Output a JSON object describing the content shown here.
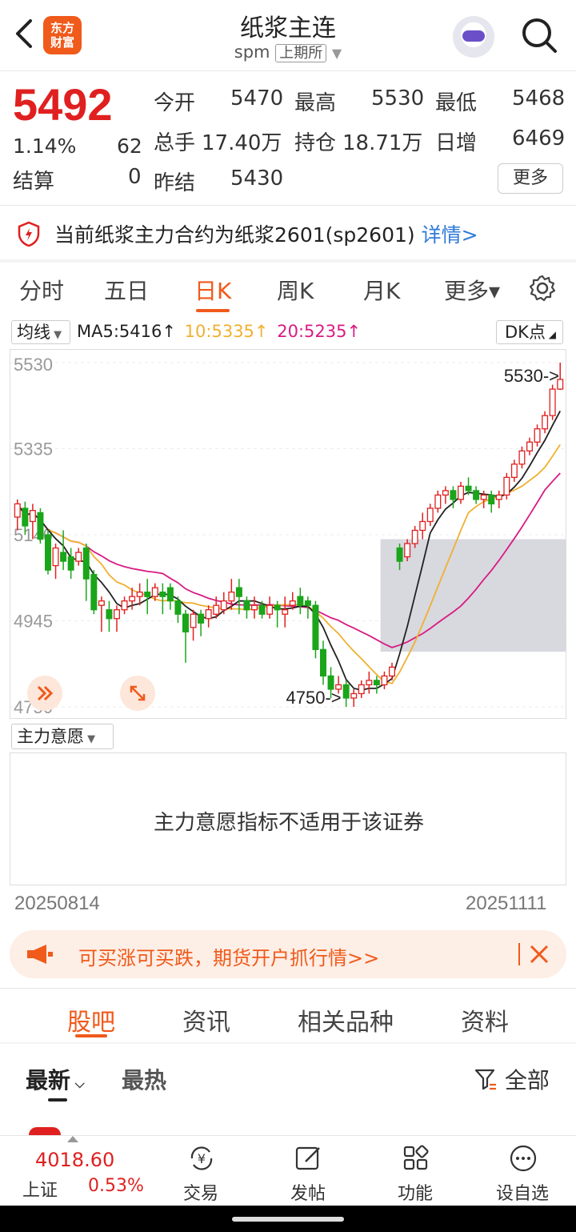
{
  "header": {
    "logo_text_1": "东方",
    "logo_text_2": "财富",
    "title": "纸浆主连",
    "code": "spm",
    "exchange": "上期所"
  },
  "quote": {
    "price": "5492",
    "change_pct": "1.14%",
    "change": "62",
    "settle_label": "结算",
    "settle": "0",
    "open_label": "今开",
    "open": "5470",
    "high_label": "最高",
    "high": "5530",
    "low_label": "最低",
    "low": "5468",
    "volume_label": "总手",
    "volume": "17.40万",
    "oi_label": "持仓",
    "oi": "18.71万",
    "daily_inc_label": "日增",
    "daily_inc": "6469",
    "prev_settle_label": "昨结",
    "prev_settle": "5430",
    "more": "更多"
  },
  "notice": {
    "text": "当前纸浆主力合约为纸浆2601(sp2601)",
    "link": "详情>"
  },
  "period_tabs": [
    "分时",
    "五日",
    "日K",
    "周K",
    "月K",
    "更多▾"
  ],
  "active_period": "日K",
  "ma_bar": {
    "select": "均线",
    "ma5": "MA5:5416",
    "ma10": "10:5335",
    "ma20": "20:5235",
    "arrow": "↑",
    "dk": "DK点"
  },
  "chart_data": {
    "type": "candlestick",
    "y_ticks": [
      "5530",
      "5335",
      "5140",
      "4945",
      "4750"
    ],
    "ylim": [
      4750,
      5530
    ],
    "x_start": "20250814",
    "x_end": "20251111",
    "high_marker": "5530->",
    "low_marker": "4750->",
    "candles": [
      [
        5180,
        5210,
        5150,
        5220
      ],
      [
        5200,
        5160,
        5140,
        5215
      ],
      [
        5170,
        5195,
        5130,
        5210
      ],
      [
        5190,
        5130,
        5120,
        5200
      ],
      [
        5140,
        5060,
        5050,
        5150
      ],
      [
        5070,
        5110,
        5040,
        5120
      ],
      [
        5100,
        5080,
        5060,
        5150
      ],
      [
        5090,
        5060,
        5040,
        5110
      ],
      [
        5080,
        5100,
        5070,
        5110
      ],
      [
        5110,
        5040,
        4990,
        5120
      ],
      [
        5050,
        4970,
        4960,
        5060
      ],
      [
        4980,
        4990,
        4920,
        5000
      ],
      [
        4970,
        4950,
        4920,
        4990
      ],
      [
        4950,
        4970,
        4920,
        4980
      ],
      [
        4970,
        4990,
        4960,
        5000
      ],
      [
        4990,
        5000,
        4970,
        5020
      ],
      [
        5000,
        5010,
        4980,
        5030
      ],
      [
        5010,
        5000,
        4960,
        5040
      ],
      [
        5000,
        5020,
        4990,
        5030
      ],
      [
        5010,
        5000,
        4960,
        5030
      ],
      [
        5020,
        4990,
        4970,
        5030
      ],
      [
        4990,
        4960,
        4940,
        5000
      ],
      [
        4960,
        4920,
        4850,
        4970
      ],
      [
        4930,
        4960,
        4900,
        4970
      ],
      [
        4960,
        4940,
        4910,
        4970
      ],
      [
        4950,
        4970,
        4930,
        4980
      ],
      [
        4960,
        4980,
        4950,
        5000
      ],
      [
        4970,
        4990,
        4960,
        5010
      ],
      [
        4990,
        5010,
        4970,
        5040
      ],
      [
        5020,
        5000,
        4960,
        5040
      ],
      [
        4990,
        4970,
        4950,
        5000
      ],
      [
        4970,
        4980,
        4950,
        5000
      ],
      [
        4980,
        4960,
        4950,
        4990
      ],
      [
        4960,
        4980,
        4950,
        5000
      ],
      [
        4980,
        4970,
        4930,
        4990
      ],
      [
        4960,
        4970,
        4930,
        5000
      ],
      [
        4980,
        4990,
        4970,
        5010
      ],
      [
        5000,
        4980,
        4960,
        5020
      ],
      [
        4990,
        4980,
        4950,
        5000
      ],
      [
        4980,
        4880,
        4860,
        4990
      ],
      [
        4880,
        4820,
        4800,
        4900
      ],
      [
        4820,
        4790,
        4770,
        4840
      ],
      [
        4790,
        4800,
        4780,
        4820
      ],
      [
        4800,
        4770,
        4750,
        4810
      ],
      [
        4770,
        4780,
        4750,
        4790
      ],
      [
        4780,
        4800,
        4770,
        4810
      ],
      [
        4800,
        4810,
        4780,
        4830
      ],
      [
        4810,
        4800,
        4780,
        4820
      ],
      [
        4800,
        4820,
        4790,
        4830
      ],
      [
        4820,
        4840,
        4810,
        4850
      ],
      [
        5110,
        5080,
        5060,
        5120
      ],
      [
        5090,
        5120,
        5080,
        5130
      ],
      [
        5120,
        5150,
        5110,
        5160
      ],
      [
        5150,
        5170,
        5130,
        5190
      ],
      [
        5170,
        5200,
        5160,
        5210
      ],
      [
        5200,
        5230,
        5190,
        5240
      ],
      [
        5230,
        5240,
        5210,
        5250
      ],
      [
        5240,
        5220,
        5200,
        5250
      ],
      [
        5220,
        5250,
        5210,
        5260
      ],
      [
        5250,
        5240,
        5230,
        5270
      ],
      [
        5240,
        5220,
        5210,
        5250
      ],
      [
        5220,
        5230,
        5200,
        5240
      ],
      [
        5230,
        5210,
        5190,
        5240
      ],
      [
        5220,
        5230,
        5200,
        5240
      ],
      [
        5230,
        5270,
        5220,
        5280
      ],
      [
        5270,
        5300,
        5260,
        5310
      ],
      [
        5300,
        5330,
        5290,
        5340
      ],
      [
        5330,
        5350,
        5320,
        5360
      ],
      [
        5350,
        5380,
        5340,
        5390
      ],
      [
        5380,
        5410,
        5370,
        5420
      ],
      [
        5410,
        5470,
        5400,
        5480
      ],
      [
        5470,
        5492,
        5468,
        5530
      ]
    ],
    "ma_colors": {
      "ma5": "#222222",
      "ma10": "#f0b030",
      "ma20": "#d81b82"
    },
    "up_color": "#e02020",
    "down_color": "#1aa51a"
  },
  "indicator": {
    "select": "主力意愿",
    "message": "主力意愿指标不适用于该证券"
  },
  "dates": {
    "start": "20250814",
    "end": "20251111"
  },
  "ad": {
    "text": "可买涨可买跌，期货开户抓行情>>"
  },
  "sub_tabs": [
    "股吧",
    "资讯",
    "相关品种",
    "资料"
  ],
  "active_sub_tab": "股吧",
  "sort": {
    "latest": "最新",
    "hot": "最热",
    "filter": "全部"
  },
  "bottom_bar": {
    "index_value": "4018.60",
    "index_name": "上证",
    "index_change": "0.53%",
    "items": [
      "交易",
      "发帖",
      "功能",
      "设自选"
    ]
  },
  "colors": {
    "accent": "#f05a1a",
    "up": "#e02020",
    "down": "#1aa51a",
    "link": "#2f7ad8"
  }
}
